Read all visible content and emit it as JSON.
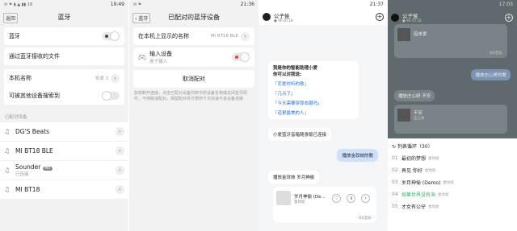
{
  "panel1": {
    "time": "19:49",
    "status_icons": "✉ ⚑ ▮ ▲ ▮▮ 18",
    "title": "蓝牙",
    "back": "返回",
    "bluetooth_label": "蓝牙",
    "receive_files_label": "通过蓝牙接收的文件",
    "device_name_label": "本机名称",
    "device_name_value": "安卓 3",
    "discoverable_label": "可被其他设备搜索到",
    "paired_section": "已配对设备",
    "devices": [
      {
        "name": "DG'S Beats"
      },
      {
        "name": "MI BT18 BLE"
      },
      {
        "name": "Sounder",
        "badge": "MIF",
        "sub": "已连接"
      },
      {
        "name": "MI BT18"
      }
    ]
  },
  "panel2": {
    "time": "21:36",
    "back": "蓝牙",
    "title": "已配对的蓝牙设备",
    "show_name_label": "在本机上显示的名称",
    "show_name_value": "MI BT18 BLE",
    "input_device_label": "输入设备",
    "input_device_sub": "用于输入",
    "unpair_label": "取消配对",
    "note": "如想断开连接，点击已配对设备列表中的设备名称或关闭蓝牙即可，不用取消配对。保留配对将方便你下次快速与该设备连接"
  },
  "panel3": {
    "time": "21:37",
    "name": "公子侯",
    "device": "MI BT18",
    "intro_line1": "我是你的智能助理小爱",
    "intro_line2": "你可以对我说:",
    "suggestions": [
      "「恋爱时听的歌」",
      "「几点了」",
      "「今天需要穿厚衣服吗」",
      "「道更最美的人」"
    ],
    "connected_msg": "小爱蓝牙音箱随身版已连接",
    "user_msg": "播放金玟岐的歌",
    "play_msg": "播放金玟岐 岁月神偷",
    "song_title": "岁月神偷 (De...",
    "song_artist": "金玟岐",
    "source": "QQ音乐"
  },
  "panel4": {
    "time": "17:03",
    "name": "公子侯",
    "device": "MI BT18",
    "track_mini_1": "因未爱",
    "source": "QQ音乐",
    "user_msg": "播放庄心妍的歌",
    "reply": "播放庄心妍 不安",
    "track_mini_2": "不安",
    "artist_mini_2": "庄心妍",
    "playlist_header": "列表循环（30）",
    "playlist": [
      {
        "num": "01",
        "title": "最初的梦想",
        "artist": "金玟岐"
      },
      {
        "num": "02",
        "title": "再见 你好",
        "artist": "金玟岐"
      },
      {
        "num": "03",
        "title": "岁月神偷 (Demo)",
        "artist": "金玟岐"
      },
      {
        "num": "04",
        "title": "如果世界没有海",
        "artist": "金玟岐",
        "active": true
      },
      {
        "num": "05",
        "title": "才女有公仔",
        "artist": "金玟岐"
      }
    ]
  }
}
